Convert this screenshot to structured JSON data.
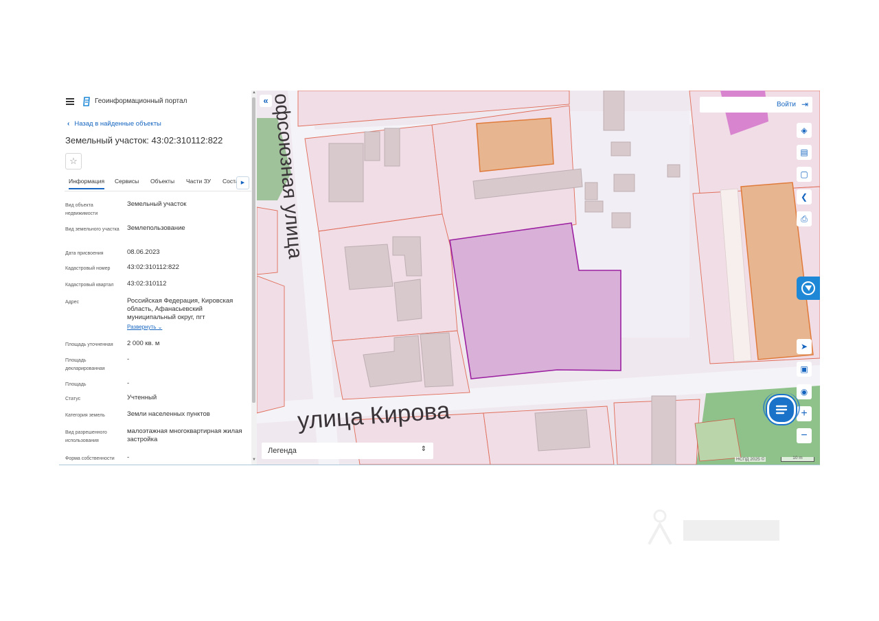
{
  "header": {
    "portal_title": "Геоинформационный портал",
    "back_link": "Назад в найденные объекты",
    "parcel_title": "Земельный участок: 43:02:310112:822"
  },
  "tabs": [
    {
      "label": "Информация",
      "active": true
    },
    {
      "label": "Сервисы"
    },
    {
      "label": "Объекты"
    },
    {
      "label": "Части ЗУ"
    },
    {
      "label": "Соста"
    }
  ],
  "info": [
    {
      "label": "Вид объекта недвижимости",
      "value": "Земельный участок"
    },
    {
      "label": "Вид земельного участка",
      "value": "Землепользование"
    },
    {
      "label": "Дата присвоения",
      "value": "08.06.2023"
    },
    {
      "label": "Кадастровый номер",
      "value": "43:02:310112:822"
    },
    {
      "label": "Кадастровый квартал",
      "value": "43:02:310112"
    },
    {
      "label": "Адрес",
      "value": "Российская Федерация, Кировская область, Афанасьевский муниципальный округ, пгт",
      "link": "Развернуть"
    },
    {
      "label": "Площадь уточненная",
      "value": "2 000 кв. м"
    },
    {
      "label": "Площадь декларированная",
      "value": "-"
    },
    {
      "label": "Площадь",
      "value": "-"
    },
    {
      "label": "Статус",
      "value": "Учтенный"
    },
    {
      "label": "Категория земель",
      "value": "Земли населенных пунктов"
    },
    {
      "label": "Вид разрешенного использования",
      "value": "малоэтажная многоквартирная жилая застройка"
    },
    {
      "label": "Форма собственности",
      "value": "-"
    }
  ],
  "map": {
    "login_label": "Войти",
    "street_1": "улица Кирова",
    "street_2": "офсоюзная улица",
    "legend_label": "Легенда",
    "attribution": "НСПД 2025 ©",
    "scale_label": "10 m",
    "colors": {
      "selected_parcel": "#d8b0d8",
      "selected_border": "#9b1fa0",
      "parcel_border": "#e0705a",
      "highlight": "#e7b58f"
    },
    "tools": [
      "layers-icon",
      "ruler-icon",
      "area-select-icon",
      "share-icon",
      "print-icon",
      "navigate-icon",
      "mini-map-icon",
      "locate-icon",
      "zoom-in-icon",
      "zoom-out-icon"
    ]
  }
}
